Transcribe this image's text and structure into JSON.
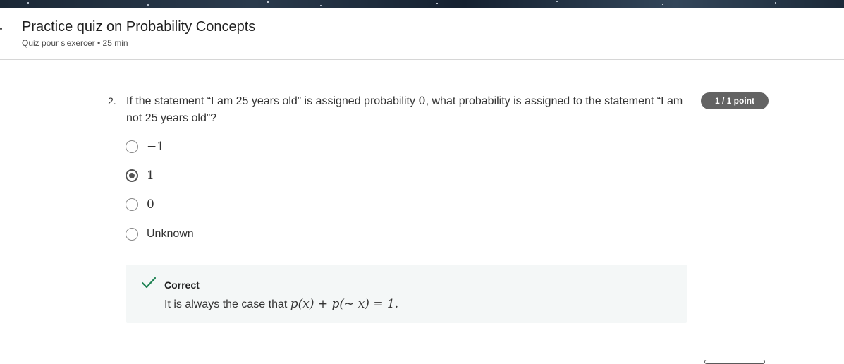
{
  "header": {
    "title": "Practice quiz on Probability Concepts",
    "subtitle": "Quiz pour s'exercer • 25 min"
  },
  "question": {
    "number": "2.",
    "text_before": "If the statement “I am 25 years old” is assigned probability ",
    "math": "0",
    "text_after": ", what probability is assigned to the statement “I am not 25 years old”?",
    "points": "1 / 1 point",
    "options": [
      {
        "label": "−1",
        "selected": false
      },
      {
        "label": "1",
        "selected": true
      },
      {
        "label": "0",
        "selected": false
      },
      {
        "label": "Unknown",
        "selected": false
      }
    ]
  },
  "feedback": {
    "status": "Correct",
    "text_before": "It is always the case that ",
    "formula": "p(x) + p(∼ x) = 1.",
    "accent_color": "#1f8354"
  }
}
